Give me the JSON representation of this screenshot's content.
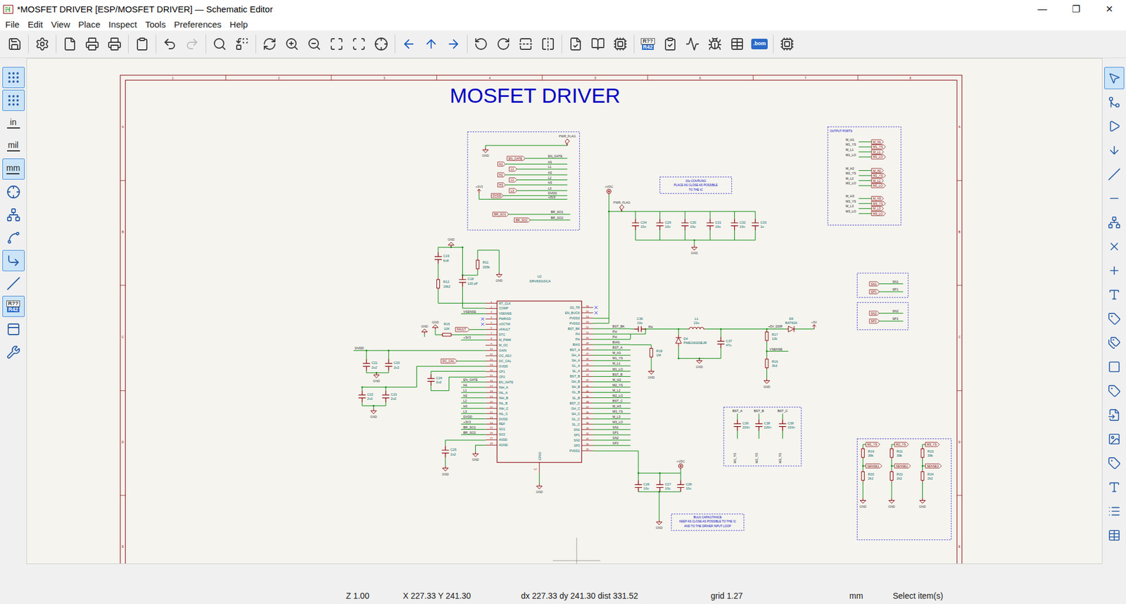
{
  "window": {
    "title": "*MOSFET DRIVER [ESP/MOSFET DRIVER] — Schematic Editor",
    "controls": [
      "—",
      "❐",
      "✕"
    ]
  },
  "menu": [
    "File",
    "Edit",
    "View",
    "Place",
    "Inspect",
    "Tools",
    "Preferences",
    "Help"
  ],
  "toolbar": {
    "annotate_icon": [
      "R??",
      "R42"
    ],
    "bom_icon": ".bom",
    "redo": {
      "disabled": true
    }
  },
  "left_toolbar": [
    {
      "kind": "icon",
      "selected": true
    },
    {
      "kind": "icon",
      "selected": true
    },
    {
      "kind": "text",
      "label": "in",
      "selected": false
    },
    {
      "kind": "text",
      "label": "mil",
      "selected": false
    },
    {
      "kind": "text",
      "label": "mm",
      "selected": true
    },
    {
      "kind": "icon",
      "selected": false
    },
    {
      "kind": "icon",
      "selected": false
    },
    {
      "kind": "icon",
      "selected": false
    },
    {
      "kind": "icon",
      "selected": true
    },
    {
      "kind": "icon",
      "selected": false
    },
    {
      "kind": "annotate",
      "label": "R??",
      "label2": "R42",
      "selected": true
    },
    {
      "kind": "icon",
      "selected": false
    },
    {
      "kind": "icon",
      "selected": false
    }
  ],
  "right_toolbar": [
    {
      "selected": true
    },
    {
      "selected": false
    },
    {
      "selected": false
    },
    {
      "selected": false
    },
    {
      "selected": false
    },
    {
      "selected": false
    },
    {
      "selected": false
    },
    {
      "selected": false
    },
    {
      "selected": false
    },
    {
      "selected": false
    },
    {
      "selected": false
    },
    {
      "selected": false
    },
    {
      "selected": false
    },
    {
      "selected": false
    },
    {
      "selected": false
    },
    {
      "selected": false
    },
    {
      "selected": false
    },
    {
      "selected": false
    },
    {
      "selected": false
    },
    {
      "selected": false
    }
  ],
  "status_bar": [
    "Z 1.00",
    "X 227.33 Y 241.30",
    "dx 227.33 dy 241.30 dist 331.52",
    "grid 1.27",
    "mm",
    "Select item(s)"
  ],
  "schematic": {
    "title": "MOSFET DRIVER",
    "border_columns": [
      "1",
      "2",
      "3",
      "4",
      "5",
      "6",
      "7",
      "8"
    ],
    "border_rows": [
      "A",
      "B",
      "C",
      "D",
      "E"
    ],
    "box_title": "OUTPUT PORTS",
    "ic": {
      "ref": "U2",
      "value": "DRV8301DCA",
      "left_pins": [
        {
          "num": "1",
          "name": "RT_CLK",
          "nc": false
        },
        {
          "num": "2",
          "name": "COMP",
          "nc": false
        },
        {
          "num": "3",
          "name": "VSENSE",
          "nc": false,
          "net": "VSENSE"
        },
        {
          "num": "4",
          "name": "PWRGD",
          "nc": true
        },
        {
          "num": "5",
          "name": "nOCTW",
          "nc": true
        },
        {
          "num": "6",
          "name": "nFAULT",
          "nc": false
        },
        {
          "num": "7",
          "name": "DTC",
          "nc": false
        },
        {
          "num": "8",
          "name": "M_PWM",
          "nc": false,
          "net": "+3V3"
        },
        {
          "num": "9",
          "name": "M_OC",
          "nc": false
        },
        {
          "num": "10",
          "name": "GAIN",
          "nc": false
        },
        {
          "num": "11",
          "name": "OC_ADJ",
          "nc": false
        },
        {
          "num": "12",
          "name": "DC_CAL",
          "nc": false
        },
        {
          "num": "13",
          "name": "GVDD",
          "nc": false
        },
        {
          "num": "14",
          "name": "CP1",
          "nc": false
        },
        {
          "num": "15",
          "name": "CP2",
          "nc": false
        },
        {
          "num": "16",
          "name": "EN_GATE",
          "nc": false,
          "net": "EN_GATE"
        },
        {
          "num": "17",
          "name": "INH_A",
          "nc": false,
          "net": "H1"
        },
        {
          "num": "18",
          "name": "INL_A",
          "nc": false,
          "net": "L1"
        },
        {
          "num": "19",
          "name": "INH_B",
          "nc": false,
          "net": "H2"
        },
        {
          "num": "20",
          "name": "INL_B",
          "nc": false,
          "net": "L2"
        },
        {
          "num": "21",
          "name": "INH_C",
          "nc": false,
          "net": "H3"
        },
        {
          "num": "22",
          "name": "INL_C",
          "nc": false,
          "net": "L3"
        },
        {
          "num": "23",
          "name": "DVDD",
          "nc": false,
          "net": "DVDD"
        },
        {
          "num": "24",
          "name": "REF",
          "nc": false,
          "net": "+3V3"
        },
        {
          "num": "25",
          "name": "SO1",
          "nc": false,
          "net": "BR_SO1"
        },
        {
          "num": "26",
          "name": "SO2",
          "nc": false,
          "net": "BR_SO2"
        },
        {
          "num": "27",
          "name": "AVDD",
          "nc": false
        },
        {
          "num": "28",
          "name": "AGND",
          "nc": false
        }
      ],
      "right_pins": [
        {
          "num": "56",
          "name": "SS_TR",
          "nc": true
        },
        {
          "num": "55",
          "name": "EN_BUCK",
          "nc": true
        },
        {
          "num": "54",
          "name": "PVDD2",
          "nc": false
        },
        {
          "num": "53",
          "name": "PVDD2",
          "nc": false
        },
        {
          "num": "52",
          "name": "BST_BK",
          "nc": false,
          "net": "BST_BK"
        },
        {
          "num": "51",
          "name": "PH",
          "nc": false,
          "net": "PH"
        },
        {
          "num": "50",
          "name": "PH",
          "nc": false,
          "net": "PH"
        },
        {
          "num": "49",
          "name": "BIAS",
          "nc": false,
          "net": "BIAS"
        },
        {
          "num": "48",
          "name": "BST_A",
          "nc": false,
          "net": "BST_A"
        },
        {
          "num": "47",
          "name": "GH_A",
          "nc": false,
          "net": "M_H1"
        },
        {
          "num": "46",
          "name": "SH_A",
          "nc": false,
          "net": "M1_YS"
        },
        {
          "num": "45",
          "name": "GL_A",
          "nc": false,
          "net": "M_L1"
        },
        {
          "num": "44",
          "name": "SL_A",
          "nc": false,
          "net": "M1_LO"
        },
        {
          "num": "43",
          "name": "BST_B",
          "nc": false,
          "net": "BST_B"
        },
        {
          "num": "42",
          "name": "GH_B",
          "nc": false,
          "net": "M_H2"
        },
        {
          "num": "41",
          "name": "SH_B",
          "nc": false,
          "net": "M2_YS"
        },
        {
          "num": "40",
          "name": "GL_B",
          "nc": false,
          "net": "M_L2"
        },
        {
          "num": "39",
          "name": "SL_B",
          "nc": false,
          "net": "M2_LO"
        },
        {
          "num": "38",
          "name": "BST_C",
          "nc": false,
          "net": "BST_C"
        },
        {
          "num": "37",
          "name": "GH_C",
          "nc": false,
          "net": "M_H3"
        },
        {
          "num": "36",
          "name": "SH_C",
          "nc": false,
          "net": "M3_YS"
        },
        {
          "num": "35",
          "name": "GL_C",
          "nc": false,
          "net": "M_L3"
        },
        {
          "num": "34",
          "name": "SL_C",
          "nc": false,
          "net": "M3_LO"
        },
        {
          "num": "33",
          "name": "SN1",
          "nc": false,
          "net": "SN1"
        },
        {
          "num": "32",
          "name": "SP1",
          "nc": false,
          "net": "SP1"
        },
        {
          "num": "31",
          "name": "SN2",
          "nc": false,
          "net": "SN2"
        },
        {
          "num": "30",
          "name": "SP2",
          "nc": false,
          "net": "SP2"
        },
        {
          "num": "29",
          "name": "PVDD1",
          "nc": false
        }
      ],
      "bottom_pin": {
        "num": "57",
        "name": "EPAD"
      }
    },
    "components": [
      {
        "ref": "C19",
        "value": "6n8"
      },
      {
        "ref": "R12",
        "value": "16k2"
      },
      {
        "ref": "C18",
        "value": "120 pF"
      },
      {
        "ref": "R11",
        "value": "205k"
      },
      {
        "ref": "R15",
        "value": "10K"
      },
      {
        "ref": "C21",
        "value": "2u2"
      },
      {
        "ref": "C20",
        "value": "2u2"
      },
      {
        "ref": "C22",
        "value": "2u2"
      },
      {
        "ref": "C23",
        "value": "2u2"
      },
      {
        "ref": "C24",
        "value": "2u2"
      },
      {
        "ref": "C25",
        "value": "2u2"
      },
      {
        "ref": "C34",
        "value": "10u"
      },
      {
        "ref": "C29",
        "value": "10u"
      },
      {
        "ref": "C30",
        "value": "10u"
      },
      {
        "ref": "C31",
        "value": "10u"
      },
      {
        "ref": "C32",
        "value": "10u"
      },
      {
        "ref": "C33",
        "value": "1u"
      },
      {
        "ref": "C35",
        "value": "10u"
      },
      {
        "ref": "L1",
        "value": "22u"
      },
      {
        "ref": "D4",
        "value": "PMEG6020EJR"
      },
      {
        "ref": "C37",
        "value": "47u"
      },
      {
        "ref": "R18",
        "value": "1M"
      },
      {
        "ref": "R17",
        "value": "10k"
      },
      {
        "ref": "R16",
        "value": "3k3"
      },
      {
        "ref": "D6",
        "value": "BAT60A"
      },
      {
        "ref": "C26",
        "value": "10u"
      },
      {
        "ref": "C27",
        "value": "10u"
      },
      {
        "ref": "C28",
        "value": "10u"
      },
      {
        "ref": "C36",
        "value": "220n"
      },
      {
        "ref": "C38",
        "value": "220n"
      },
      {
        "ref": "C39",
        "value": "220n"
      },
      {
        "ref": "R19",
        "value": "39k"
      },
      {
        "ref": "R20",
        "value": "2k2"
      },
      {
        "ref": "R21",
        "value": "39k"
      },
      {
        "ref": "R22",
        "value": "2k2"
      },
      {
        "ref": "R23",
        "value": "39k"
      },
      {
        "ref": "R24",
        "value": "2k2"
      }
    ],
    "power_symbols": [
      {
        "text": "GND",
        "kind": "gnd_up"
      },
      {
        "text": "GND",
        "kind": "gnd"
      },
      {
        "text": "GND",
        "kind": "gnd_up"
      },
      {
        "text": "GND",
        "kind": "gnd_up"
      },
      {
        "text": "GND",
        "kind": "gnd"
      },
      {
        "text": "GND",
        "kind": "gnd"
      },
      {
        "text": "GND",
        "kind": "gnd"
      },
      {
        "text": "GND",
        "kind": "gnd"
      },
      {
        "text": "GND",
        "kind": "gnd"
      },
      {
        "text": "GND",
        "kind": "gnd"
      },
      {
        "text": "GND",
        "kind": "gnd"
      },
      {
        "text": "GND",
        "kind": "gnd"
      },
      {
        "text": "GND",
        "kind": "gnd"
      },
      {
        "text": "GND",
        "kind": "gnd"
      },
      {
        "text": "GND",
        "kind": "gnd"
      },
      {
        "text": "GND",
        "kind": "gnd"
      },
      {
        "text": "GND",
        "kind": "gnd"
      },
      {
        "text": "GND",
        "kind": "gnd"
      },
      {
        "text": "+VDC",
        "kind": "circle"
      },
      {
        "text": "+VDC",
        "kind": "circle"
      },
      {
        "text": "+5V",
        "kind": "arrow"
      },
      {
        "text": "+3V3",
        "kind": "arrow"
      },
      {
        "text": "PWR_FLAG",
        "kind": "flag"
      },
      {
        "text": "PWR_FLAG",
        "kind": "flag"
      }
    ],
    "net_texts": [
      {
        "text": "EN_GATE"
      },
      {
        "text": "H1"
      },
      {
        "text": "L1"
      },
      {
        "text": "H2"
      },
      {
        "text": "L2"
      },
      {
        "text": "H3"
      },
      {
        "text": "L3"
      },
      {
        "text": "DVDD"
      },
      {
        "text": "+3V3"
      },
      {
        "text": "BR_SO1"
      },
      {
        "text": "BR_SO2"
      },
      {
        "text": "M_H1"
      },
      {
        "text": "M1_YS"
      },
      {
        "text": "M_L1"
      },
      {
        "text": "M1_LO"
      },
      {
        "text": "M_H2"
      },
      {
        "text": "M2_YS"
      },
      {
        "text": "M_L2"
      },
      {
        "text": "M2_LO"
      },
      {
        "text": "M_H3"
      },
      {
        "text": "M3_YS"
      },
      {
        "text": "M_L3"
      },
      {
        "text": "M3_LO"
      },
      {
        "text": "SN1"
      },
      {
        "text": "SP1"
      },
      {
        "text": "SN2"
      },
      {
        "text": "SP2"
      },
      {
        "text": "BST_A"
      },
      {
        "text": "BST_B"
      },
      {
        "text": "BST_C"
      },
      {
        "text": "M1_YS"
      },
      {
        "text": "M2_YS"
      },
      {
        "text": "M3_YS"
      },
      {
        "text": "+5V_DDR"
      },
      {
        "text": "VSENSE"
      },
      {
        "text": "PH"
      },
      {
        "text": "DVDD"
      }
    ],
    "global_labels": [
      {
        "text": "EN_GATE"
      },
      {
        "text": "H1"
      },
      {
        "text": "L1"
      },
      {
        "text": "H2"
      },
      {
        "text": "L2"
      },
      {
        "text": "H3"
      },
      {
        "text": "L3"
      },
      {
        "text": "DVDD"
      },
      {
        "text": "BR_SO1"
      },
      {
        "text": "BR_SO2"
      },
      {
        "text": "FAULT"
      },
      {
        "text": "DC_CAL"
      },
      {
        "text": "M_H1"
      },
      {
        "text": "M1_YS"
      },
      {
        "text": "M_L1"
      },
      {
        "text": "M1_LO"
      },
      {
        "text": "M_H2"
      },
      {
        "text": "M2_YS"
      },
      {
        "text": "M_L2"
      },
      {
        "text": "M2_LO"
      },
      {
        "text": "M_H3"
      },
      {
        "text": "M3_YS"
      },
      {
        "text": "M_L3"
      },
      {
        "text": "M3_LO"
      },
      {
        "text": "SN1"
      },
      {
        "text": "SP1"
      },
      {
        "text": "SN2"
      },
      {
        "text": "SP2"
      },
      {
        "text": "M1_YS"
      },
      {
        "text": "SENSE1"
      },
      {
        "text": "M2_YS"
      },
      {
        "text": "SENSE2"
      },
      {
        "text": "M3_YS"
      },
      {
        "text": "SENSE3"
      }
    ],
    "notes": [
      {
        "lines": [
          "10u COUPLING",
          "PLACE AS CLOSE AS POSSIBLE",
          "TO THE IC"
        ]
      },
      {
        "lines": [
          "BULK CAPACITANCE",
          "KEEP AS CLOSE AS POSSIBLE TO THE IC",
          "AND TO THE DRIVER INPUT LOOP"
        ]
      }
    ]
  }
}
